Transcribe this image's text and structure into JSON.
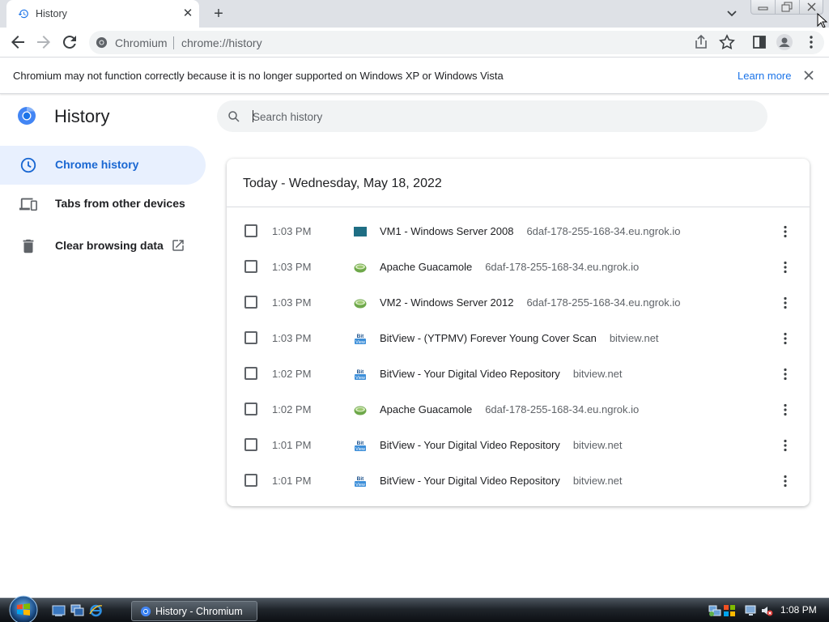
{
  "window": {
    "tab_title": "History",
    "tab_close_glyph": "✕",
    "new_tab_glyph": "+"
  },
  "toolbar": {
    "origin": "Chromium",
    "url": "chrome://history"
  },
  "infobar": {
    "message": "Chromium may not function correctly because it is no longer supported on Windows XP or Windows Vista",
    "link": "Learn more"
  },
  "page": {
    "title": "History",
    "search_placeholder": "Search history"
  },
  "sidebar": {
    "items": [
      {
        "label": "Chrome history",
        "icon": "clock-icon",
        "active": true
      },
      {
        "label": "Tabs from other devices",
        "icon": "devices-icon",
        "active": false
      },
      {
        "label": "Clear browsing data",
        "icon": "trash-icon",
        "active": false
      }
    ]
  },
  "history": {
    "date_header": "Today - Wednesday, May 18, 2022",
    "entries": [
      {
        "time": "1:03 PM",
        "title": "VM1 - Windows Server 2008",
        "domain": "6daf-178-255-168-34.eu.ngrok.io",
        "favicon": "vm-icon"
      },
      {
        "time": "1:03 PM",
        "title": "Apache Guacamole",
        "domain": "6daf-178-255-168-34.eu.ngrok.io",
        "favicon": "guacamole-icon"
      },
      {
        "time": "1:03 PM",
        "title": "VM2 - Windows Server 2012",
        "domain": "6daf-178-255-168-34.eu.ngrok.io",
        "favicon": "guacamole-icon"
      },
      {
        "time": "1:03 PM",
        "title": "BitView - (YTPMV) Forever Young Cover Scan",
        "domain": "bitview.net",
        "favicon": "bitview-icon"
      },
      {
        "time": "1:02 PM",
        "title": "BitView - Your Digital Video Repository",
        "domain": "bitview.net",
        "favicon": "bitview-icon"
      },
      {
        "time": "1:02 PM",
        "title": "Apache Guacamole",
        "domain": "6daf-178-255-168-34.eu.ngrok.io",
        "favicon": "guacamole-icon"
      },
      {
        "time": "1:01 PM",
        "title": "BitView - Your Digital Video Repository",
        "domain": "bitview.net",
        "favicon": "bitview-icon"
      },
      {
        "time": "1:01 PM",
        "title": "BitView - Your Digital Video Repository",
        "domain": "bitview.net",
        "favicon": "bitview-icon"
      }
    ]
  },
  "taskbar": {
    "task_label": "History - Chromium",
    "clock": "1:08 PM"
  },
  "colors": {
    "accent": "#1a73e8",
    "active_nav_bg": "#e8f0fe",
    "active_nav_text": "#1967d2",
    "tabstrip_bg": "#dee1e6"
  }
}
